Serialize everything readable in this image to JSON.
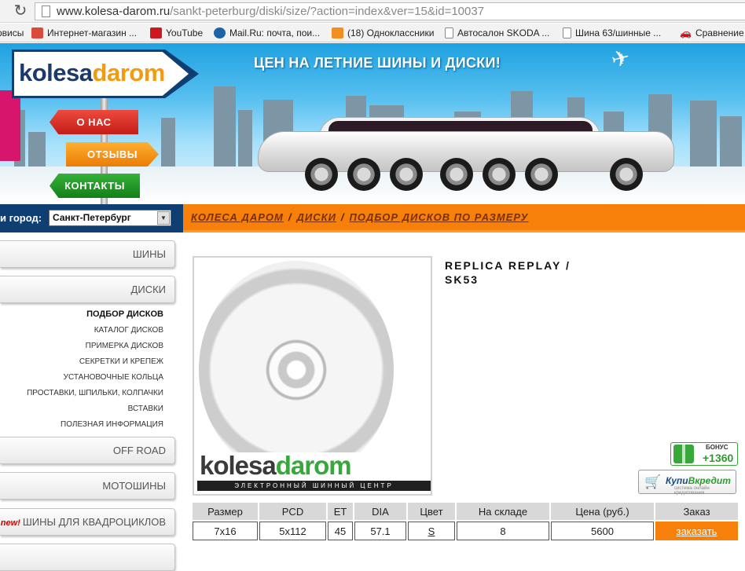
{
  "browser": {
    "url_host": "www.kolesa-darom.ru",
    "url_path": "/sankt-peterburg/diski/size/?action=index&ver=15&id=10037",
    "bookmarks": [
      {
        "label": "рвисы",
        "icon": "services-icon",
        "color": "#f2f2f2"
      },
      {
        "label": "Интернет-магазин ...",
        "icon": "store-icon",
        "color": "#d94a3a"
      },
      {
        "label": "YouTube",
        "icon": "youtube-icon",
        "color": "#cc181e"
      },
      {
        "label": "Mail.Ru: почта, пои...",
        "icon": "mailru-icon",
        "color": "#1e63a8"
      },
      {
        "label": "(18) Одноклассники",
        "icon": "odnoklassniki-icon",
        "color": "#f28e1e"
      },
      {
        "label": "Автосалон SKODA ...",
        "icon": "page-icon",
        "color": "#ffffff"
      },
      {
        "label": "Шина 63/шинные ...",
        "icon": "page-icon",
        "color": "#ffffff"
      },
      {
        "label": "Сравнение",
        "icon": "car-icon",
        "color": "#f2f2f2"
      }
    ]
  },
  "banner": {
    "headline": "ЦЕН НА ЛЕТНИЕ ШИНЫ И ДИСКИ!",
    "logo_part1": "kolesa",
    "logo_part2": "darom",
    "signs": {
      "about": "О НАС",
      "reviews": "ОТЗЫВЫ",
      "contacts": "КОНТАКТЫ"
    }
  },
  "city": {
    "label": "и город:",
    "selected": "Санкт-Петербург"
  },
  "breadcrumbs": [
    "КОЛЕСА ДАРОМ",
    "ДИСКИ",
    "ПОДБОР ДИСКОВ ПО РАЗМЕРУ"
  ],
  "breadcrumb_separator": "/",
  "menu": {
    "tires": "ШИНЫ",
    "disks": "ДИСКИ",
    "disk_sub": [
      "ПОДБОР ДИСКОВ",
      "КАТАЛОГ ДИСКОВ",
      "ПРИМЕРКА ДИСКОВ",
      "СЕКРЕТКИ И КРЕПЕЖ",
      "УСТАНОВОЧНЫЕ КОЛЬЦА",
      "ПРОСТАВКИ, ШПИЛЬКИ, КОЛПАЧКИ",
      "ВСТАВКИ",
      "ПОЛЕЗНАЯ ИНФОРМАЦИЯ"
    ],
    "offroad": "OFF ROAD",
    "moto": "МОТОШИНЫ",
    "new_badge": "new!",
    "atv": "ШИНЫ ДЛЯ КВАДРОЦИКЛОВ"
  },
  "product": {
    "title_line1": "REPLICA REPLAY /",
    "title_line2": "SK53",
    "image_brand_part1": "kolesa",
    "image_brand_part2": "darom",
    "image_brand_tagline": "ЭЛЕКТРОННЫЙ ШИННЫЙ ЦЕНТР"
  },
  "bonus": {
    "label": "БОНУС",
    "value": "+1360"
  },
  "kupi": {
    "part1": "Купи",
    "part2": "Вкредит",
    "tagline": "система онлайн кредитования"
  },
  "specs": {
    "headers": [
      "Размер",
      "PCD",
      "ET",
      "DIA",
      "Цвет",
      "На складе",
      "Цена (руб.)",
      "Заказ"
    ],
    "row": [
      "7x16",
      "5x112",
      "45",
      "57.1",
      "S",
      "8",
      "5600"
    ],
    "order_label": "заказать"
  },
  "colors": {
    "accent_orange": "#f7800b",
    "navy": "#0f3f72",
    "brand_green": "#37a83a"
  }
}
